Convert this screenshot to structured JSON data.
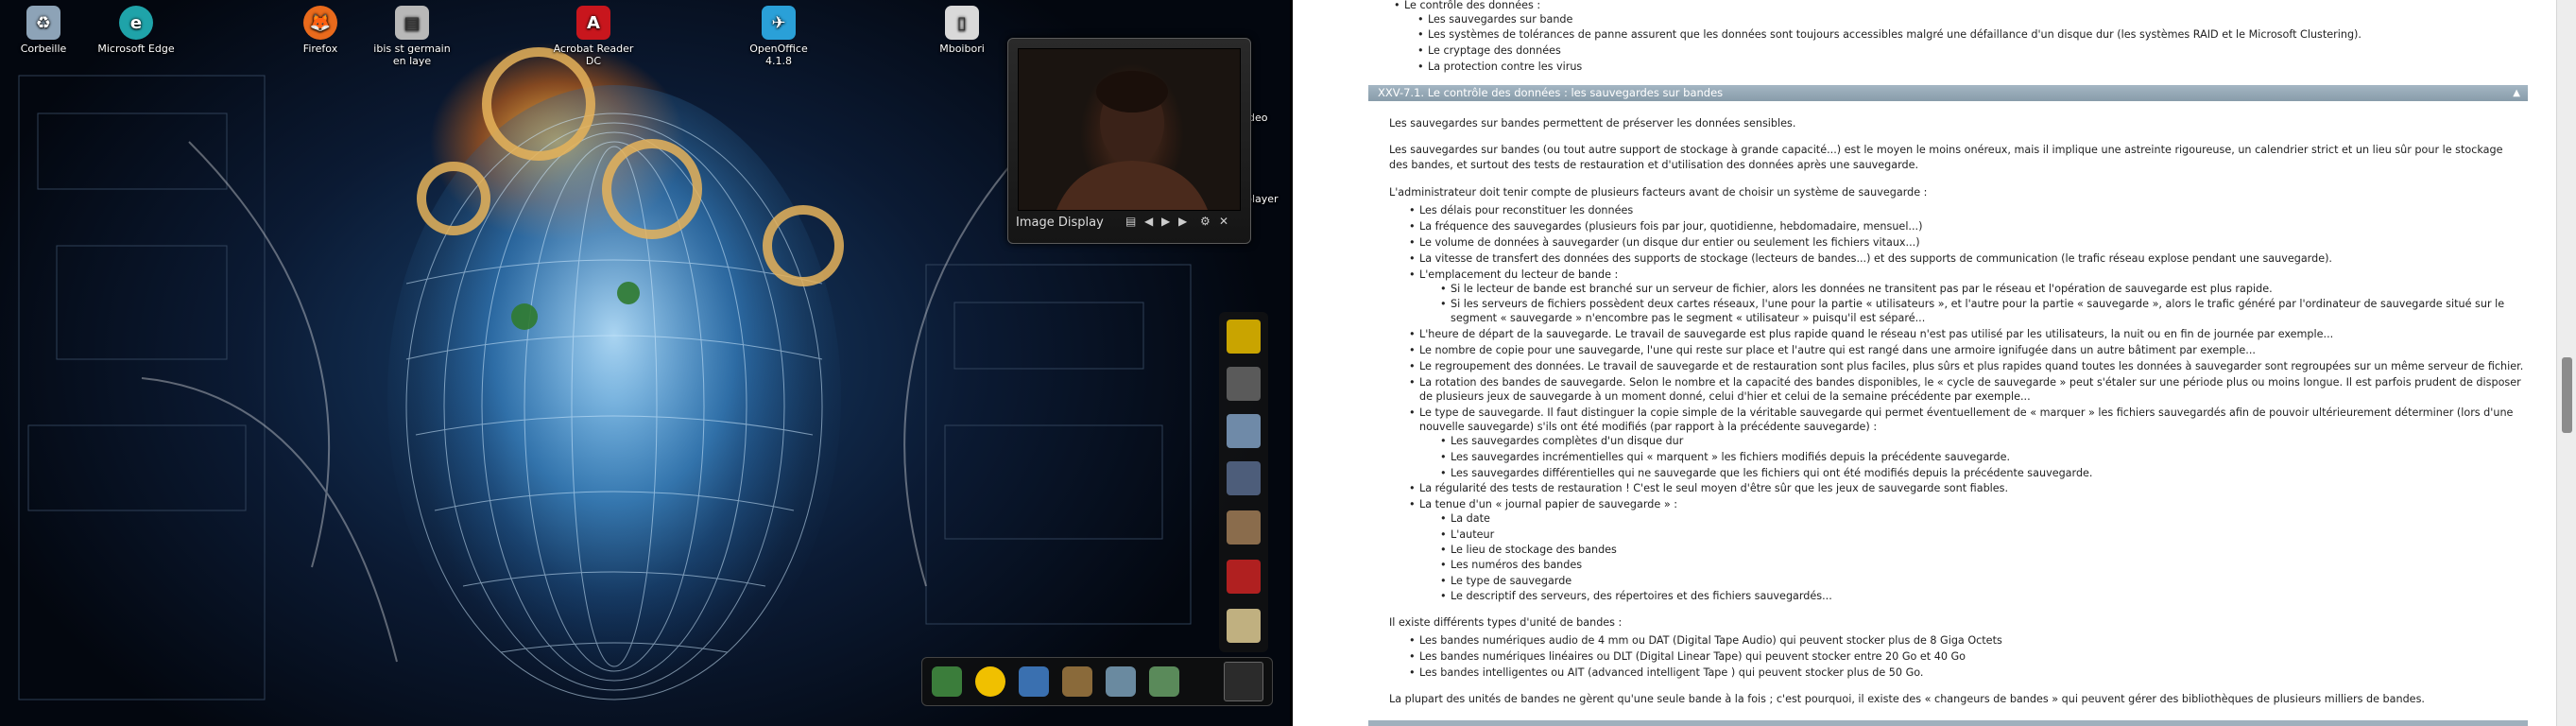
{
  "desktop": {
    "icons": [
      {
        "label": "Corbeille",
        "icon": "recycle-bin-icon",
        "color": "#8da3b7"
      },
      {
        "label": "Microsoft Edge",
        "icon": "edge-icon",
        "color": "#1fa3a9"
      },
      {
        "label": "Firefox",
        "icon": "firefox-icon",
        "color": "#e96a1c"
      },
      {
        "label": "ibis st germain en laye",
        "icon": "document-icon",
        "color": "#b8b8b8"
      },
      {
        "label": "Acrobat Reader DC",
        "icon": "acrobat-icon",
        "color": "#c8161d"
      },
      {
        "label": "OpenOffice 4.1.8",
        "icon": "openoffice-icon",
        "color": "#2aa0d8"
      },
      {
        "label": "Mboibori",
        "icon": "file-icon",
        "color": "#d9d9d9"
      }
    ],
    "image_display": {
      "caption": "Image Display"
    },
    "side_labels": [
      "ideo",
      "player"
    ]
  },
  "document": {
    "top_items": [
      "Le contrôle des données :",
      "Les sauvegardes sur bande",
      "Les systèmes de tolérances de panne assurent que les données sont toujours accessibles malgré une défaillance d'un disque dur (les systèmes RAID et le Microsoft Clustering).",
      "Le cryptage des données",
      "La protection contre les virus"
    ],
    "section_title": "XXV-7.1. Le contrôle des données : les sauvegardes sur bandes",
    "para1": "Les sauvegardes sur bandes permettent de préserver les données sensibles.",
    "para2a": "Les sauvegardes sur bandes (ou tout autre support de stockage à grande capacité...) est le moyen le moins onéreux, mais il implique une astreinte rigoureuse, un calendrier strict et un lieu sûr pour le stockage",
    "para2b": "des bandes, et surtout des tests de restauration et d'utilisation des données après une sauvegarde.",
    "para3": "L'administrateur doit tenir compte de plusieurs facteurs avant de choisir un système de sauvegarde :",
    "factors": [
      "Les délais pour reconstituer les données",
      "La fréquence des sauvegardes (plusieurs fois par jour, quotidienne, hebdomadaire, mensuel...)",
      "Le volume de données à sauvegarder (un disque dur entier ou seulement les fichiers vitaux...)",
      "La vitesse de transfert des données des supports de stockage (lecteurs de bandes...) et des supports de communication (le trafic réseau explose pendant une sauvegarde).",
      "L'emplacement du lecteur de bande :"
    ],
    "emplacement_sub": [
      "Si le lecteur de bande est branché sur un serveur de fichier, alors les données ne transitent pas par le réseau et l'opération de sauvegarde est plus rapide.",
      "Si les serveurs de fichiers possèdent deux cartes réseaux, l'une pour la partie « utilisateurs », et l'autre pour la partie « sauvegarde », alors le trafic généré par l'ordinateur de sauvegarde situé sur le",
      "segment « sauvegarde » n'encombre pas le segment « utilisateur » puisqu'il est séparé..."
    ],
    "factors2": [
      "L'heure de départ de la sauvegarde. Le travail de sauvegarde est plus rapide quand le réseau n'est pas utilisé par les utilisateurs, la nuit ou en fin de journée par exemple...",
      "Le nombre de copie pour une sauvegarde, l'une qui reste sur place et l'autre qui est rangé dans une armoire ignifugée dans un autre bâtiment par exemple...",
      "Le regroupement des données. Le travail de sauvegarde et de restauration sont plus faciles, plus sûrs et plus rapides quand toutes les données à sauvegarder sont regroupées sur un même serveur de fichier.",
      "La rotation des bandes de sauvegarde. Selon le nombre et la capacité des bandes disponibles, le « cycle de sauvegarde » peut s'étaler sur une période plus ou moins longue. Il est parfois prudent de disposer",
      "de plusieurs jeux de sauvegarde à un moment donné, celui d'hier et celui de la semaine précédente par exemple...",
      "Le type de sauvegarde. Il faut distinguer la copie simple de la véritable sauvegarde qui permet éventuellement de « marquer » les fichiers sauvegardés afin de pouvoir ultérieurement déterminer (lors d'une",
      "nouvelle sauvegarde) s'ils ont été modifiés (par rapport à la précédente sauvegarde) :"
    ],
    "types": [
      "Les sauvegardes complètes d'un disque dur",
      "Les sauvegardes incrémentielles qui « marquent » les fichiers modifiés depuis la précédente sauvegarde.",
      "Les sauvegardes différentielles qui ne sauvegarde que les fichiers qui ont été modifiés depuis la précédente sauvegarde."
    ],
    "factors3": [
      "La régularité des tests de restauration ! C'est le seul moyen d'être sûr que les jeux de sauvegarde sont fiables.",
      "La tenue d'un « journal papier de sauvegarde » :"
    ],
    "journal": [
      "La date",
      "L'auteur",
      "Le lieu de stockage des bandes",
      "Les numéros des bandes",
      "Le type de sauvegarde",
      "Le descriptif des serveurs, des répertoires et des fichiers sauvegardés..."
    ],
    "para4": "Il existe différents types d'unité de bandes :",
    "units": [
      "Les bandes numériques audio de 4 mm ou DAT (Digital Tape Audio) qui peuvent stocker plus de 8 Giga Octets",
      "Les bandes numériques linéaires ou DLT (Digital Linear Tape) qui peuvent stocker entre 20 Go et 40 Go",
      "Les bandes intelligentes ou AIT (advanced intelligent Tape ) qui peuvent stocker plus de 50 Go."
    ],
    "para5": "La plupart des unités de bandes ne gèrent qu'une seule bande à la fois ; c'est pourquoi, il existe des « changeurs de bandes » qui peuvent gérer des bibliothèques de plusieurs milliers de bandes."
  }
}
